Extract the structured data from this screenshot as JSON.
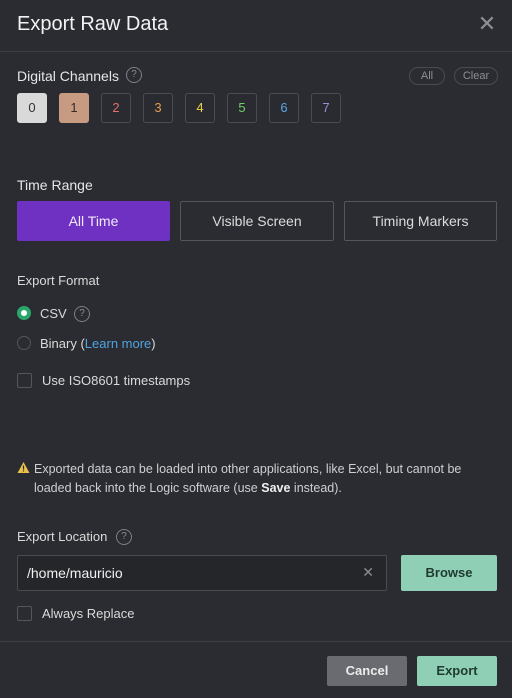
{
  "dialog": {
    "title": "Export Raw Data"
  },
  "digital": {
    "label": "Digital Channels",
    "all": "All",
    "clear": "Clear",
    "channels": [
      {
        "label": "0",
        "color": "#c8c8c8",
        "selected": true,
        "fill": "#d9d9d9",
        "text": "#333"
      },
      {
        "label": "1",
        "color": "#c79b82",
        "selected": true,
        "fill": "#c79b82",
        "text": "#3a2b24"
      },
      {
        "label": "2",
        "color": "#e36d72",
        "selected": false
      },
      {
        "label": "3",
        "color": "#e39b4f",
        "selected": false
      },
      {
        "label": "4",
        "color": "#e8d14b",
        "selected": false
      },
      {
        "label": "5",
        "color": "#6fcf6a",
        "selected": false
      },
      {
        "label": "6",
        "color": "#5aa7e8",
        "selected": false
      },
      {
        "label": "7",
        "color": "#a38ad8",
        "selected": false
      }
    ]
  },
  "time_range": {
    "label": "Time Range",
    "options": [
      "All Time",
      "Visible Screen",
      "Timing Markers"
    ],
    "active": "All Time"
  },
  "format": {
    "label": "Export Format",
    "csv": "CSV",
    "binary_prefix": "Binary (",
    "learn_more": "Learn more",
    "binary_suffix": ")",
    "selected": "CSV",
    "iso_label": "Use ISO8601 timestamps"
  },
  "warning": {
    "line1": "Exported data can be loaded into other applications, like Excel, but cannot be",
    "line2_prefix": "loaded back into the Logic software (use ",
    "line2_bold": "Save",
    "line2_suffix": " instead)."
  },
  "location": {
    "label": "Export Location",
    "path": "/home/mauricio",
    "browse": "Browse",
    "always_replace": "Always Replace"
  },
  "footer": {
    "cancel": "Cancel",
    "export": "Export"
  },
  "colors": {
    "accent": "#6e31c1",
    "green_button": "#8fcfb6",
    "radio_on": "#2aa66a",
    "link": "#4fa3e0",
    "warning": "#e8c24a"
  }
}
